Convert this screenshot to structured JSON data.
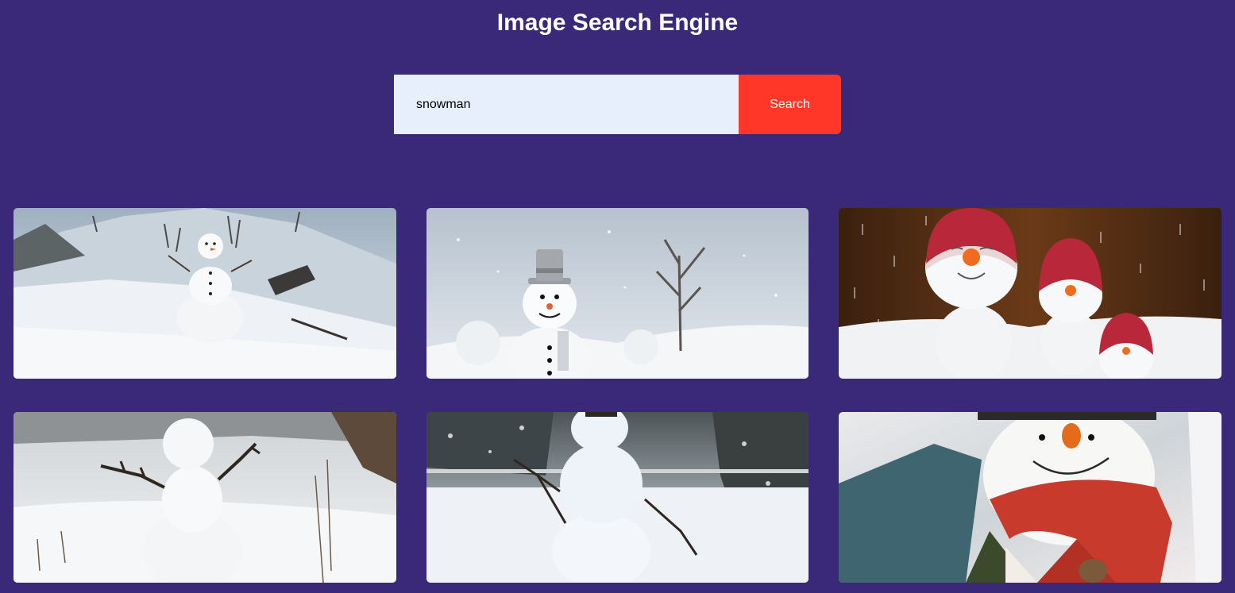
{
  "header": {
    "title": "Image Search Engine"
  },
  "search": {
    "value": "snowman",
    "button_label": "Search"
  },
  "results": [
    {
      "subject": "snowman on snowy hillside"
    },
    {
      "subject": "snowman with silver top hat"
    },
    {
      "subject": "snowman figurines with red hats"
    },
    {
      "subject": "small snowman with stick arms"
    },
    {
      "subject": "snowman with stick arms in winter park"
    },
    {
      "subject": "snowman plush with red scarf"
    }
  ],
  "colors": {
    "background": "#3a2879",
    "input_bg": "#e8effc",
    "button_bg": "#ff3729",
    "title_text": "#ffffff"
  }
}
